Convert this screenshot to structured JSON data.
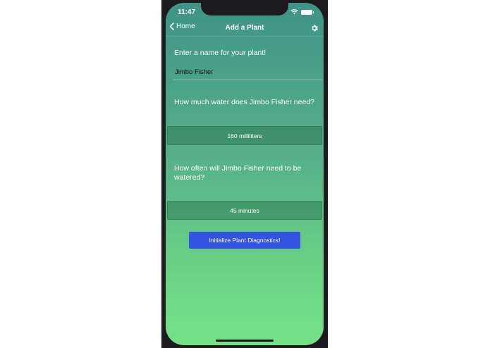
{
  "status_bar": {
    "time": "11:47",
    "icons": [
      "wifi-icon",
      "battery-icon"
    ]
  },
  "navbar": {
    "back_label": "Home",
    "title": "Add a Plant",
    "back_icon": "chevron-left-icon",
    "settings_icon": "gear-icon"
  },
  "form": {
    "name_prompt": "Enter a name for your plant!",
    "name_value": "Jimbo Fisher",
    "water_prompt": "How much water does Jimbo Fisher need?",
    "water_amount": "160 milliliters",
    "frequency_prompt": "How often will Jimbo Fisher need to be watered?",
    "frequency_value": "45 minutes",
    "submit_label": "Initialize Plant Diagnostics!"
  },
  "colors": {
    "gradient_top": "#3f9486",
    "gradient_bottom": "#75e286",
    "button": "#3354e3"
  }
}
